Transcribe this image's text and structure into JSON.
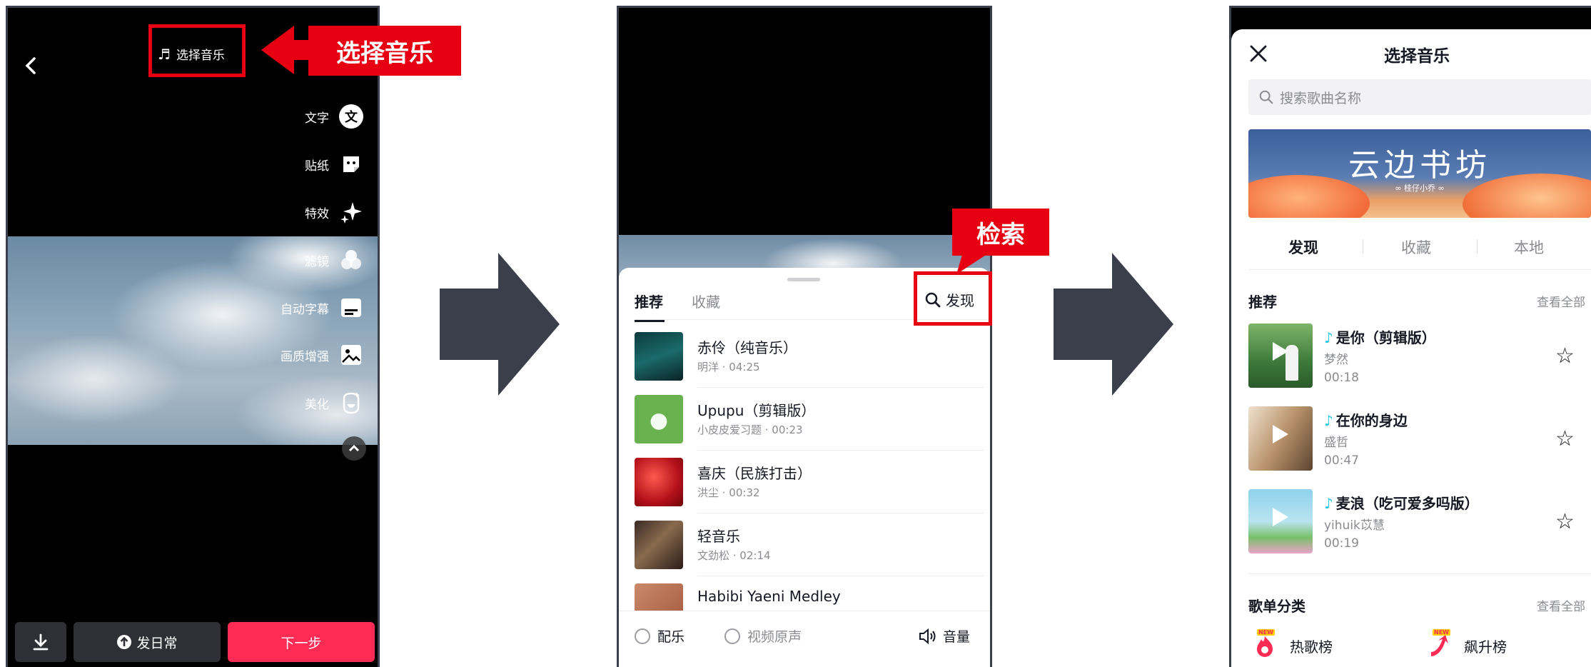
{
  "screen1": {
    "select_music": "选择音乐",
    "annotation": "选择音乐",
    "tools": [
      {
        "label": "文字",
        "icon": "text-icon",
        "glyph": "文"
      },
      {
        "label": "贴纸",
        "icon": "sticker-icon",
        "glyph": ""
      },
      {
        "label": "特效",
        "icon": "effects-icon",
        "glyph": ""
      },
      {
        "label": "滤镜",
        "icon": "filter-icon",
        "glyph": ""
      },
      {
        "label": "自动字幕",
        "icon": "caption-icon",
        "glyph": ""
      },
      {
        "label": "画质增强",
        "icon": "enhance-icon",
        "glyph": ""
      },
      {
        "label": "美化",
        "icon": "beautify-icon",
        "glyph": ""
      }
    ],
    "daily_label": "发日常",
    "next_label": "下一步"
  },
  "screen2": {
    "tabs": [
      "推荐",
      "收藏"
    ],
    "discover_label": "发现",
    "annotation": "检索",
    "songs": [
      {
        "title": "赤伶（纯音乐）",
        "sub": "明洋 · 04:25"
      },
      {
        "title": "Upupu（剪辑版）",
        "sub": "小皮皮爱习题 · 00:23"
      },
      {
        "title": "喜庆（民族打击）",
        "sub": "洪尘 · 00:32"
      },
      {
        "title": "轻音乐",
        "sub": "文劲松 · 02:14"
      },
      {
        "title": "Habibi Yaeni Medley",
        "sub": ""
      }
    ],
    "bgm_label": "配乐",
    "original_label": "视频原声",
    "volume_label": "音量"
  },
  "screen3": {
    "title": "选择音乐",
    "search_placeholder": "搜索歌曲名称",
    "banner_text": "云边书坊",
    "banner_sub": "∞ 桂仔小乔 ∞",
    "tabs": [
      "发现",
      "收藏",
      "本地"
    ],
    "rec_header": "推荐",
    "see_all": "查看全部",
    "songs": [
      {
        "title": "是你（剪辑版）",
        "artist": "梦然",
        "duration": "00:18"
      },
      {
        "title": "在你的身边",
        "artist": "盛哲",
        "duration": "00:47"
      },
      {
        "title": "麦浪（吃可爱多吗版）",
        "artist": "yihuik苡慧",
        "duration": "00:19"
      }
    ],
    "playlist_header": "歌单分类",
    "see_all2": "查看全部",
    "charts": [
      "热歌榜",
      "飙升榜"
    ],
    "chart_badge": "NEW"
  },
  "colors": {
    "accent_red": "#e60012",
    "primary_pink": "#fe2c55",
    "arrow_gray": "#3a3f4b",
    "note_cyan": "#25c6e6"
  }
}
